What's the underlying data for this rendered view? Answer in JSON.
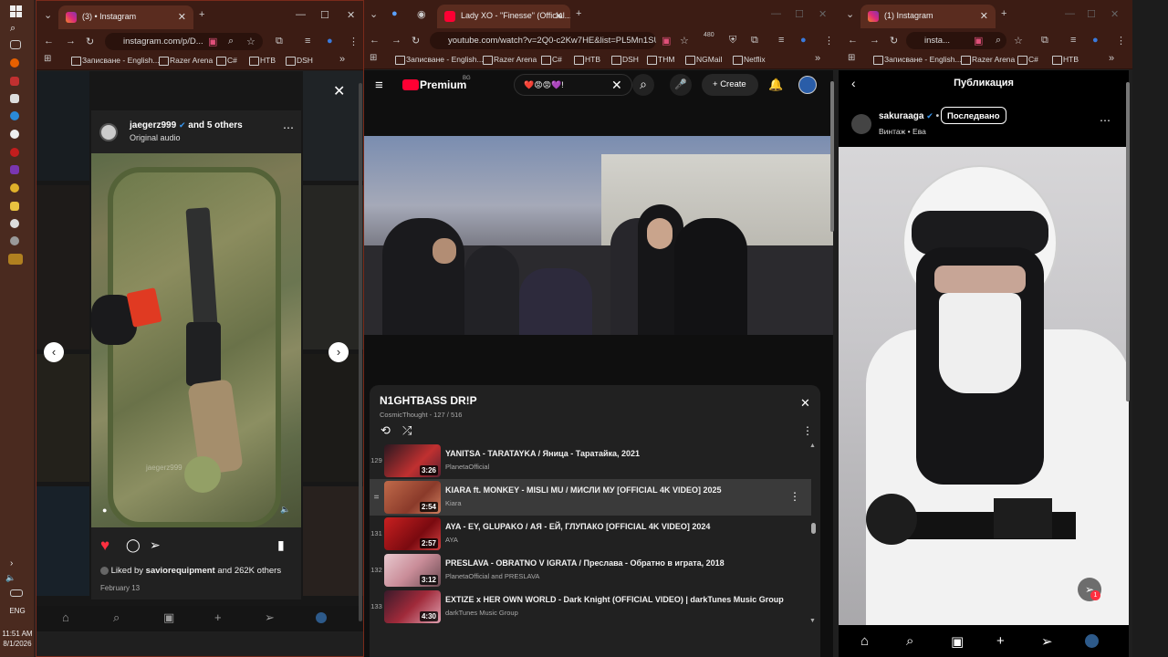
{
  "taskbar": {
    "lang": "ENG",
    "time": "11:51 AM",
    "date": "8/1/2026"
  },
  "left_window": {
    "tab_title": "(3) • Instagram",
    "url": "instagram.com/p/D...",
    "bookmarks": [
      "Записване - English...",
      "Razer Arena",
      "C#",
      "HTB",
      "DSH"
    ],
    "post": {
      "author": "jaegerz999",
      "and_others": "and 5 others",
      "audio": "Original audio",
      "liked_by_prefix": "Liked by",
      "liked_by_user": "saviorequipment",
      "liked_by_suffix": "and 262K others",
      "date": "February 13",
      "watermark": "jaegerz999"
    }
  },
  "middle_window": {
    "tab_title": "Lady XO - \"Finesse\" (Official...",
    "url": "youtube.com/watch?v=2Q0-c2Kw7HE&list=PL5Mn1SU...",
    "bookmarks": [
      "Записване - English...",
      "Razer Arena",
      "C#",
      "HTB",
      "DSH",
      "THM",
      "NGMail",
      "Netflix"
    ],
    "extension_badge": "480",
    "header": {
      "logo": "Premium",
      "region": "BG",
      "search_value": "❤️😡😡💜!",
      "create_label": "Create"
    },
    "playlist": {
      "title": "N1GHTBASS DR!P",
      "meta": "CosmicThought - 127 / 516",
      "items": [
        {
          "num": "129",
          "title": "YANITSA - TARATAYKA / Яница - Таратайка, 2021",
          "channel": "PlanetaOfficial",
          "duration": "3:26",
          "color": "#c03030"
        },
        {
          "num": "",
          "title": "KIARA ft. MONKEY - MISLI MU / МИСЛИ МУ [OFFICIAL 4K VIDEO] 2025",
          "channel": "Kiara",
          "duration": "2:54",
          "color": "#b04a3a"
        },
        {
          "num": "131",
          "title": "AYA - EY, GLUPAKO / АЯ - ЕЙ, ГЛУПАКО [OFFICIAL 4K VIDEO] 2024",
          "channel": "AYA",
          "duration": "2:57",
          "color": "#a81e1e"
        },
        {
          "num": "132",
          "title": "PRESLAVA - OBRATNO V IGRATA / Преслава - Обратно в играта, 2018",
          "channel": "PlanetaOfficial and PRESLAVA",
          "duration": "3:12",
          "color": "#c9a0a8"
        },
        {
          "num": "133",
          "title": "EXTIZE x HER OWN WORLD - Dark Knight (OFFICIAL VIDEO) | darkTunes Music Group",
          "channel": "darkTunes Music Group",
          "duration": "4:30",
          "color": "#8c2430"
        }
      ]
    }
  },
  "right_window": {
    "tab_title": "(1) Instagram",
    "url": "insta...",
    "bookmarks": [
      "Записване - English...",
      "Razer Arena",
      "C#",
      "HTB"
    ],
    "header_title": "Публикация",
    "post": {
      "author": "sakuraaga",
      "follow_label": "Последвано",
      "subtitle": "Винтаж • Ева"
    },
    "notif_count": "1"
  }
}
